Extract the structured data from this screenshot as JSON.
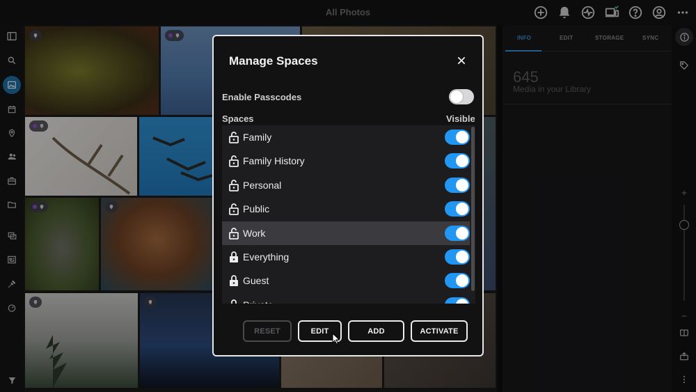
{
  "app": {
    "title": "All Photos"
  },
  "topbar": {
    "icons": [
      "add-circle-icon",
      "bell-icon",
      "activity-icon",
      "devices-icon",
      "help-icon",
      "account-icon",
      "more-icon"
    ]
  },
  "leftbar": {
    "items": [
      "sidebar-toggle-icon",
      "search-icon",
      "photos-icon",
      "calendar-icon",
      "location-icon",
      "people-icon",
      "briefcase-icon",
      "folder-icon",
      "albums-icon",
      "gallery-icon",
      "tools-icon",
      "dashboard-icon",
      "filter-icon"
    ],
    "active": "photos-icon"
  },
  "info_panel": {
    "tabs": [
      "INFO",
      "EDIT",
      "STORAGE",
      "SYNC"
    ],
    "active_tab": "INFO",
    "media_count": "645",
    "media_label": "Media in your Library"
  },
  "modal": {
    "title": "Manage Spaces",
    "enable_passcodes_label": "Enable Passcodes",
    "enable_passcodes_on": false,
    "spaces_header": "Spaces",
    "visible_header": "Visible",
    "spaces": [
      {
        "name": "Family",
        "locked": false,
        "visible": true
      },
      {
        "name": "Family History",
        "locked": false,
        "visible": true
      },
      {
        "name": "Personal",
        "locked": false,
        "visible": true
      },
      {
        "name": "Public",
        "locked": false,
        "visible": true
      },
      {
        "name": "Work",
        "locked": false,
        "visible": true,
        "highlighted": true
      },
      {
        "name": "Everything",
        "locked": true,
        "visible": true
      },
      {
        "name": "Guest",
        "locked": true,
        "visible": true
      },
      {
        "name": "Private",
        "locked": true,
        "visible": true
      }
    ],
    "buttons": {
      "reset": "RESET",
      "edit": "EDIT",
      "add": "ADD",
      "activate": "ACTIVATE"
    }
  },
  "colors": {
    "accent": "#2196f3",
    "tab_accent": "#3b8fd6",
    "modal_bg": "#121213"
  }
}
